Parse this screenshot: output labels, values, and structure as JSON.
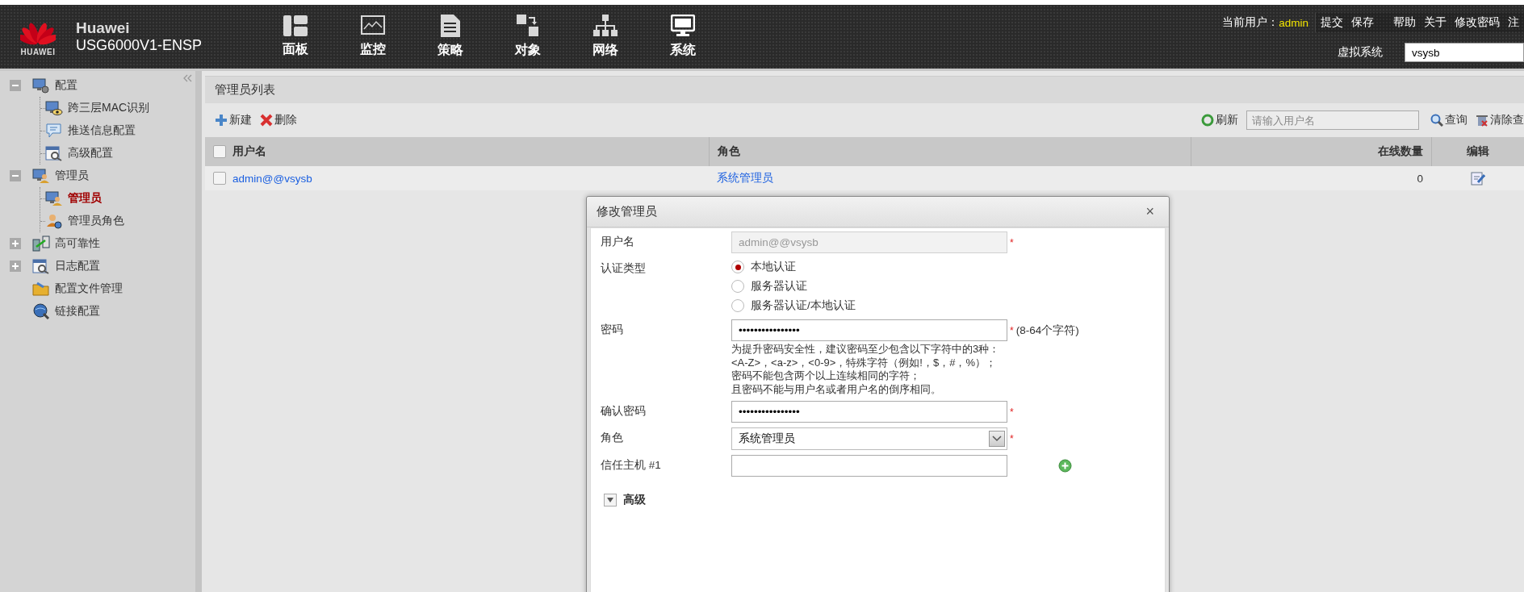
{
  "header": {
    "logo_text": "HUAWEI",
    "brand": "Huawei",
    "model": "USG6000V1-ENSP",
    "nav": [
      {
        "label": "面板",
        "kind": "dashboard"
      },
      {
        "label": "监控",
        "kind": "monitor"
      },
      {
        "label": "策略",
        "kind": "document"
      },
      {
        "label": "对象",
        "kind": "objects"
      },
      {
        "label": "网络",
        "kind": "network"
      },
      {
        "label": "系统",
        "kind": "system"
      }
    ],
    "user_label": "当前用户：",
    "user": "admin",
    "links": [
      "提交",
      "保存",
      "帮助",
      "关于",
      "修改密码",
      "注"
    ],
    "vsys_label": "虚拟系统",
    "vsys_value": "vsysb"
  },
  "sidebar": {
    "items": [
      {
        "label": "配置",
        "kind": "monitor-gear",
        "expanded": true,
        "selected": false,
        "children": [
          {
            "label": "跨三层MAC识别",
            "kind": "monitor-eye",
            "selected": false
          },
          {
            "label": "推送信息配置",
            "kind": "chat",
            "selected": false
          },
          {
            "label": "高级配置",
            "kind": "calendar-wrench",
            "selected": false
          }
        ]
      },
      {
        "label": "管理员",
        "kind": "admin",
        "expanded": true,
        "selected": false,
        "children": [
          {
            "label": "管理员",
            "kind": "admin",
            "selected": true
          },
          {
            "label": "管理员角色",
            "kind": "admin-gear",
            "selected": false
          }
        ]
      },
      {
        "label": "高可靠性",
        "kind": "transfer",
        "expanded": false,
        "selected": false
      },
      {
        "label": "日志配置",
        "kind": "calendar-wrench",
        "expanded": false,
        "selected": false
      },
      {
        "label": "配置文件管理",
        "kind": "folder",
        "selected": false
      },
      {
        "label": "链接配置",
        "kind": "globe",
        "selected": false
      }
    ]
  },
  "panel": {
    "title": "管理员列表",
    "actions": [
      {
        "label": "新建",
        "kind": "add"
      },
      {
        "label": "删除",
        "kind": "delete"
      }
    ],
    "refresh": "刷新",
    "search": {
      "placeholder": "请输入用户名"
    },
    "query": "查询",
    "clear": "清除查",
    "table": {
      "header_checked": false,
      "columns": [
        "用户名",
        "角色",
        "在线数量",
        "编辑"
      ],
      "rows": [
        {
          "checked": false,
          "username": "admin@@vsysb",
          "role": "系统管理员",
          "online": "0"
        }
      ]
    }
  },
  "dialog": {
    "title": "修改管理员",
    "close": "×",
    "fields": [
      {
        "kind": "text",
        "label": "用户名",
        "value": "admin@@vsysb",
        "disabled": true,
        "required_mark": "*"
      },
      {
        "kind": "radio",
        "label": "认证类型",
        "options": [
          {
            "label": "本地认证",
            "selected": true
          },
          {
            "label": "服务器认证",
            "selected": false
          },
          {
            "label": "服务器认证/本地认证",
            "selected": false
          }
        ]
      },
      {
        "kind": "text",
        "label": "密码",
        "value": "••••••••••••••••",
        "disabled": false,
        "required_mark": "*",
        "hint": "(8-64个字符)",
        "notes": [
          "为提升密码安全性，建议密码至少包含以下字符中的3种：",
          "<A-Z>，<a-z>，<0-9>，特殊字符（例如!，$，#，%）；",
          "密码不能包含两个以上连续相同的字符；",
          "且密码不能与用户名或者用户名的倒序相同。"
        ]
      },
      {
        "kind": "text",
        "label": "确认密码",
        "value": "••••••••••••••••",
        "disabled": false,
        "required_mark": "*"
      },
      {
        "kind": "select",
        "label": "角色",
        "value": "系统管理员",
        "required_mark": "*"
      },
      {
        "kind": "text",
        "label": "信任主机 #1",
        "disabled": false,
        "addable": true
      }
    ],
    "advanced": {
      "label": "高级",
      "expanded": false
    }
  }
}
